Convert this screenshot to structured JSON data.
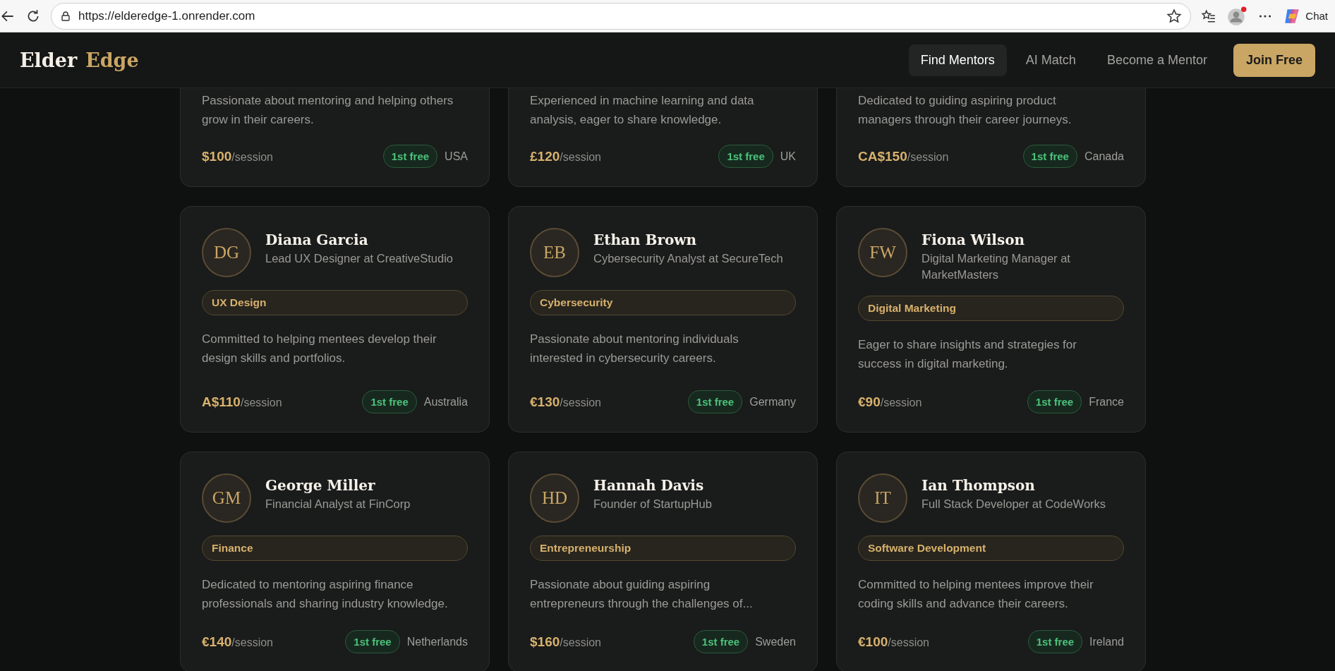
{
  "browser": {
    "url": "https://elderedge-1.onrender.com",
    "chat_label": "Chat"
  },
  "header": {
    "logo": [
      "Elder",
      "Edge"
    ],
    "nav": [
      {
        "label": "Find Mentors",
        "selected": true
      },
      {
        "label": "AI Match",
        "selected": false
      },
      {
        "label": "Become a Mentor",
        "selected": false
      }
    ],
    "cta": "Join Free"
  },
  "mentors": [
    {
      "description": "Passionate about mentoring and helping others grow in their careers.",
      "price": "$100",
      "unit": "/session",
      "badge": "1st free",
      "country": "USA"
    },
    {
      "description": "Experienced in machine learning and data analysis, eager to share knowledge.",
      "price": "£120",
      "unit": "/session",
      "badge": "1st free",
      "country": "UK"
    },
    {
      "description": "Dedicated to guiding aspiring product managers through their career journeys.",
      "price": "CA$150",
      "unit": "/session",
      "badge": "1st free",
      "country": "Canada"
    },
    {
      "initials": "DG",
      "name": "Diana Garcia",
      "role": "Lead UX Designer at CreativeStudio",
      "tag": "UX Design",
      "description": "Committed to helping mentees develop their design skills and portfolios.",
      "price": "A$110",
      "unit": "/session",
      "badge": "1st free",
      "country": "Australia"
    },
    {
      "initials": "EB",
      "name": "Ethan Brown",
      "role": "Cybersecurity Analyst at SecureTech",
      "tag": "Cybersecurity",
      "description": "Passionate about mentoring individuals interested in cybersecurity careers.",
      "price": "€130",
      "unit": "/session",
      "badge": "1st free",
      "country": "Germany"
    },
    {
      "initials": "FW",
      "name": "Fiona Wilson",
      "role": "Digital Marketing Manager at MarketMasters",
      "tag": "Digital Marketing",
      "description": "Eager to share insights and strategies for success in digital marketing.",
      "price": "€90",
      "unit": "/session",
      "badge": "1st free",
      "country": "France"
    },
    {
      "initials": "GM",
      "name": "George Miller",
      "role": "Financial Analyst at FinCorp",
      "tag": "Finance",
      "description": "Dedicated to mentoring aspiring finance professionals and sharing industry knowledge.",
      "price": "€140",
      "unit": "/session",
      "badge": "1st free",
      "country": "Netherlands"
    },
    {
      "initials": "HD",
      "name": "Hannah Davis",
      "role": "Founder of StartupHub",
      "tag": "Entrepreneurship",
      "description": "Passionate about guiding aspiring entrepreneurs through the challenges of...",
      "price": "$160",
      "unit": "/session",
      "badge": "1st free",
      "country": "Sweden"
    },
    {
      "initials": "IT",
      "name": "Ian Thompson",
      "role": "Full Stack Developer at CodeWorks",
      "tag": "Software Development",
      "description": "Committed to helping mentees improve their coding skills and advance their careers.",
      "price": "€100",
      "unit": "/session",
      "badge": "1st free",
      "country": "Ireland"
    }
  ]
}
